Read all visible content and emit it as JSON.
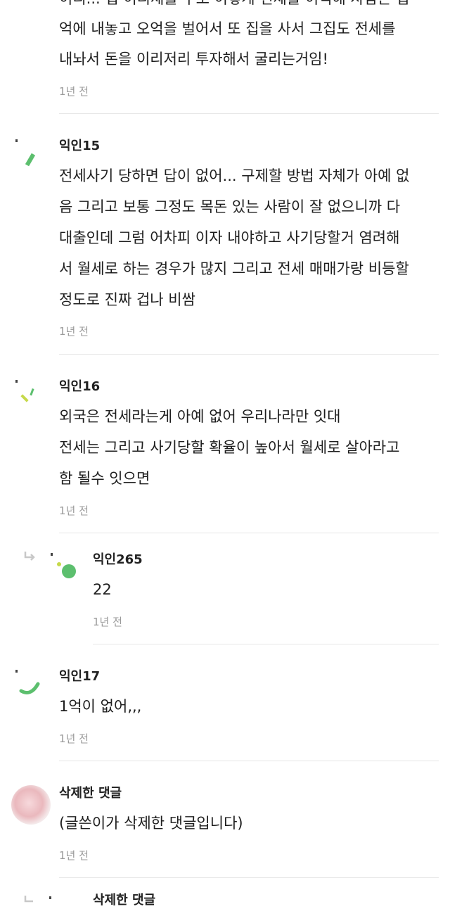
{
  "comments": [
    {
      "body": [
        "이리... 집 이리세를 수도 이렇게 전세를 이익해 사람은 집",
        "억에 내놓고 오억을 벌어서 또 집을 사서 그집도 전세를",
        "내놔서 돈을 이리저리 투자해서 굴리는거임!"
      ],
      "time": "1년 전"
    },
    {
      "author": "익인15",
      "body": [
        "전세사기 당하면 답이 없어... 구제할 방법 자체가 아예 없",
        "음 그리고 보통 그정도 목돈 있는 사람이 잘 없으니까 다",
        "대출인데 그럼 어차피 이자 내야하고 사기당할거 염려해",
        "서 월세로 하는 경우가 많지 그리고 전세 매매가랑 비등할",
        "정도로 진짜 겁나 비쌈"
      ],
      "time": "1년 전"
    },
    {
      "author": "익인16",
      "body": [
        "외국은 전세라는게 아예 없어 우리나라만 잇대",
        "전세는 그리고 사기당할 확율이 높아서 월세로 살아라고",
        "함 될수 잇으면"
      ],
      "time": "1년 전"
    },
    {
      "author": "익인265",
      "body": [
        "22"
      ],
      "time": "1년 전",
      "reply": true
    },
    {
      "author": "익인17",
      "body": [
        "1억이 없어,,,"
      ],
      "time": "1년 전"
    },
    {
      "author": "삭제한 댓글",
      "body": [
        "(글쓴이가 삭제한 댓글입니다)"
      ],
      "time": "1년 전"
    },
    {
      "author": "삭제한 댓글",
      "reply": true
    }
  ],
  "colors": {
    "avatar_green": "#5cbf6e",
    "avatar_lime": "#c6d94a",
    "divider": "#e6e6e6",
    "time": "#9a9a9a"
  },
  "icons": [
    "reply-arrow-icon",
    "avatar-icon"
  ]
}
